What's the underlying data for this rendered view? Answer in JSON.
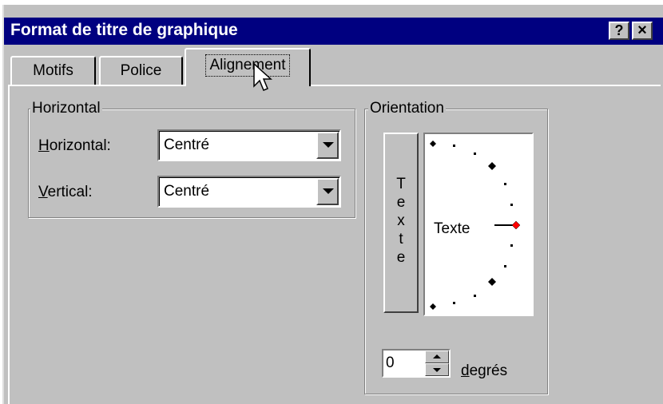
{
  "window": {
    "title": "Format de titre de graphique",
    "help_button": "?",
    "close_button": "×"
  },
  "tabs": [
    {
      "label": "Motifs",
      "active": false
    },
    {
      "label": "Police",
      "active": false
    },
    {
      "label": "Alignement",
      "active": true
    }
  ],
  "alignment": {
    "group_title": "Horizontal",
    "horizontal": {
      "label_accel": "H",
      "label_rest": "orizontal:",
      "value": "Centré"
    },
    "vertical": {
      "label_accel": "V",
      "label_rest": "ertical:",
      "value": "Centré"
    }
  },
  "orientation": {
    "group_title": "Orientation",
    "vertical_text_chars": [
      "T",
      "e",
      "x",
      "t",
      "e"
    ],
    "dial_label": "Texte",
    "degrees_value": "0",
    "degrees_label_accel": "d",
    "degrees_label_rest": "egrés"
  },
  "colors": {
    "titlebar": "#000080",
    "dialog_face": "#c0c0c0",
    "dial_selected": "#ff0000"
  }
}
